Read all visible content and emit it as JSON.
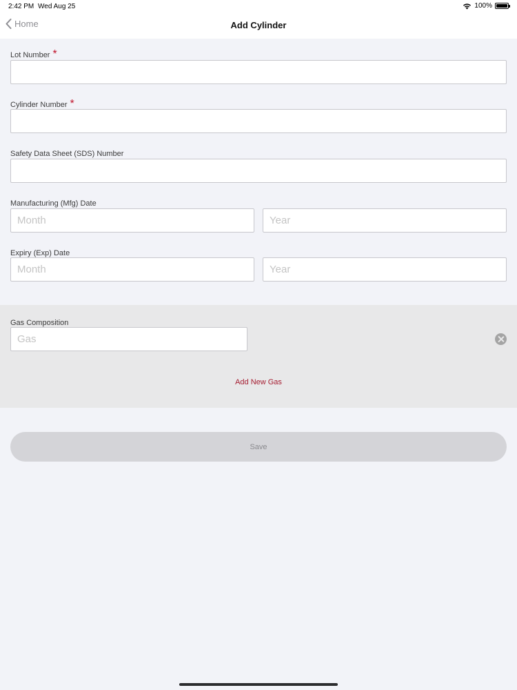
{
  "status_bar": {
    "time": "2:42 PM",
    "date": "Wed Aug 25",
    "battery": "100%",
    "wifi_icon": "wifi-icon",
    "battery_icon": "battery-icon"
  },
  "nav": {
    "back_label": "Home",
    "title": "Add Cylinder"
  },
  "form": {
    "lot_number": {
      "label": "Lot Number",
      "required_mark": "*",
      "value": ""
    },
    "cylinder_number": {
      "label": "Cylinder Number",
      "required_mark": "*",
      "value": ""
    },
    "sds_number": {
      "label": "Safety Data Sheet (SDS) Number",
      "value": ""
    },
    "mfg_date": {
      "label": "Manufacturing (Mfg) Date",
      "month_placeholder": "Month",
      "year_placeholder": "Year"
    },
    "exp_date": {
      "label": "Expiry (Exp) Date",
      "month_placeholder": "Month",
      "year_placeholder": "Year"
    }
  },
  "gas": {
    "label": "Gas Composition",
    "gas_placeholder": "Gas",
    "add_label": "Add New Gas"
  },
  "actions": {
    "save_label": "Save"
  },
  "colors": {
    "accent": "#a51c30",
    "required": "#c0142a",
    "background": "#f2f3f8",
    "gas_section": "#e8e8e9",
    "save_button": "#d4d4d8"
  }
}
